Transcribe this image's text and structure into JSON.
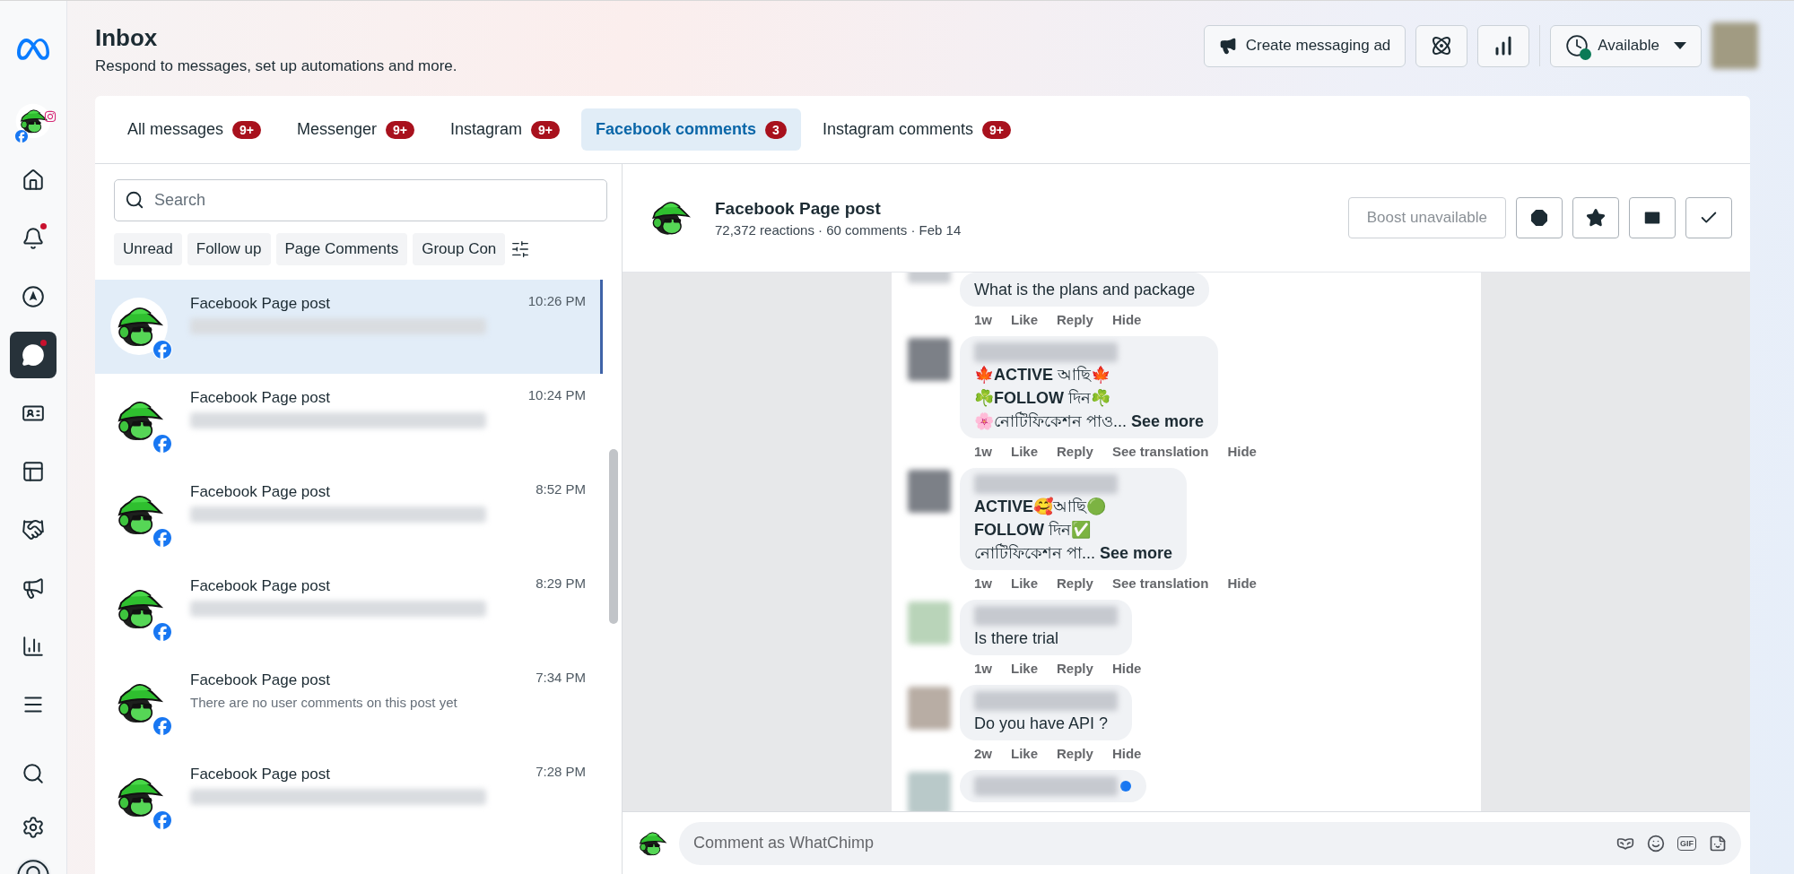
{
  "nav": {
    "items": [
      {
        "selected": false,
        "notification": false
      },
      {
        "selected": false,
        "notification": true
      },
      {
        "selected": false,
        "notification": false
      },
      {
        "selected": true,
        "notification": true
      },
      {
        "selected": false,
        "notification": false
      },
      {
        "selected": false,
        "notification": false
      },
      {
        "selected": false,
        "notification": false
      },
      {
        "selected": false,
        "notification": false
      },
      {
        "selected": false,
        "notification": false
      },
      {
        "selected": false,
        "notification": false
      }
    ],
    "bottom_items": [
      {
        "selected": false
      },
      {
        "selected": false
      }
    ]
  },
  "header": {
    "title": "Inbox",
    "subtitle": "Respond to messages, set up automations and more.",
    "create_ad": "Create messaging ad",
    "status": "Available",
    "online": true
  },
  "tabs": [
    {
      "label": "All messages",
      "count": "9+",
      "selected": false
    },
    {
      "label": "Messenger",
      "count": "9+",
      "selected": false
    },
    {
      "label": "Instagram",
      "count": "9+",
      "selected": false
    },
    {
      "label": "Facebook comments",
      "count": "3",
      "selected": true
    },
    {
      "label": "Instagram comments",
      "count": "9+",
      "selected": false
    }
  ],
  "search": {
    "placeholder": "Search"
  },
  "filters": [
    "Unread",
    "Follow up",
    "Page Comments",
    "Group Con"
  ],
  "conversations": [
    {
      "title": "Facebook Page post",
      "time": "10:26 PM",
      "selected": true
    },
    {
      "title": "Facebook Page post",
      "time": "10:24 PM",
      "selected": false
    },
    {
      "title": "Facebook Page post",
      "time": "8:52 PM",
      "selected": false
    },
    {
      "title": "Facebook Page post",
      "time": "8:29 PM",
      "selected": false
    },
    {
      "title": "Facebook Page post",
      "time": "7:34 PM",
      "preview": "There are no user comments on this post yet",
      "selected": false
    },
    {
      "title": "Facebook Page post",
      "time": "7:28 PM",
      "selected": false
    }
  ],
  "post": {
    "title": "Facebook Page post",
    "meta": "72,372 reactions · 60 comments · Feb 14",
    "boost": {
      "label": "Boost unavailable",
      "disabled": true
    }
  },
  "comments": [
    {
      "blurred_name": false,
      "lines": [
        "What is the plans and package"
      ],
      "time": "1w",
      "actions": [
        "Like",
        "Reply",
        "Hide"
      ]
    },
    {
      "blurred_name": true,
      "lines": [
        "🍁**ACTIVE** আছি🍁",
        "☘️**FOLLOW** দিন☘️",
        "🌸নোটিফিকেশন পাও..."
      ],
      "see_more": "See more",
      "time": "1w",
      "actions": [
        "Like",
        "Reply",
        "See translation",
        "Hide"
      ]
    },
    {
      "blurred_name": true,
      "lines": [
        "**ACTIVE**🥰আছি🟢",
        "**FOLLOW** দিন✅",
        "নোটিফিকেশন পা..."
      ],
      "see_more": "See more",
      "time": "1w",
      "actions": [
        "Like",
        "Reply",
        "See translation",
        "Hide"
      ]
    },
    {
      "blurred_name": true,
      "lines": [
        "Is there trial"
      ],
      "time": "1w",
      "actions": [
        "Like",
        "Reply",
        "Hide"
      ]
    },
    {
      "blurred_name": true,
      "lines": [
        "Do you have API ?"
      ],
      "time": "2w",
      "actions": [
        "Like",
        "Reply",
        "Hide"
      ]
    },
    {
      "blurred_name": true,
      "verified": true
    }
  ],
  "composer": {
    "placeholder": "Comment as WhatChimp",
    "gif_label": "GIF"
  }
}
